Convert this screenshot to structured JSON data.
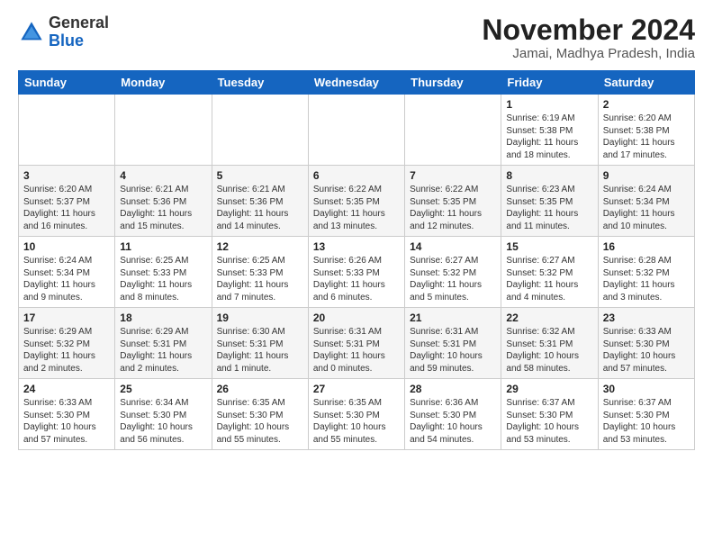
{
  "logo": {
    "general": "General",
    "blue": "Blue"
  },
  "header": {
    "month_title": "November 2024",
    "subtitle": "Jamai, Madhya Pradesh, India"
  },
  "weekdays": [
    "Sunday",
    "Monday",
    "Tuesday",
    "Wednesday",
    "Thursday",
    "Friday",
    "Saturday"
  ],
  "weeks": [
    [
      {
        "day": "",
        "info": ""
      },
      {
        "day": "",
        "info": ""
      },
      {
        "day": "",
        "info": ""
      },
      {
        "day": "",
        "info": ""
      },
      {
        "day": "",
        "info": ""
      },
      {
        "day": "1",
        "info": "Sunrise: 6:19 AM\nSunset: 5:38 PM\nDaylight: 11 hours and 18 minutes."
      },
      {
        "day": "2",
        "info": "Sunrise: 6:20 AM\nSunset: 5:38 PM\nDaylight: 11 hours and 17 minutes."
      }
    ],
    [
      {
        "day": "3",
        "info": "Sunrise: 6:20 AM\nSunset: 5:37 PM\nDaylight: 11 hours and 16 minutes."
      },
      {
        "day": "4",
        "info": "Sunrise: 6:21 AM\nSunset: 5:36 PM\nDaylight: 11 hours and 15 minutes."
      },
      {
        "day": "5",
        "info": "Sunrise: 6:21 AM\nSunset: 5:36 PM\nDaylight: 11 hours and 14 minutes."
      },
      {
        "day": "6",
        "info": "Sunrise: 6:22 AM\nSunset: 5:35 PM\nDaylight: 11 hours and 13 minutes."
      },
      {
        "day": "7",
        "info": "Sunrise: 6:22 AM\nSunset: 5:35 PM\nDaylight: 11 hours and 12 minutes."
      },
      {
        "day": "8",
        "info": "Sunrise: 6:23 AM\nSunset: 5:35 PM\nDaylight: 11 hours and 11 minutes."
      },
      {
        "day": "9",
        "info": "Sunrise: 6:24 AM\nSunset: 5:34 PM\nDaylight: 11 hours and 10 minutes."
      }
    ],
    [
      {
        "day": "10",
        "info": "Sunrise: 6:24 AM\nSunset: 5:34 PM\nDaylight: 11 hours and 9 minutes."
      },
      {
        "day": "11",
        "info": "Sunrise: 6:25 AM\nSunset: 5:33 PM\nDaylight: 11 hours and 8 minutes."
      },
      {
        "day": "12",
        "info": "Sunrise: 6:25 AM\nSunset: 5:33 PM\nDaylight: 11 hours and 7 minutes."
      },
      {
        "day": "13",
        "info": "Sunrise: 6:26 AM\nSunset: 5:33 PM\nDaylight: 11 hours and 6 minutes."
      },
      {
        "day": "14",
        "info": "Sunrise: 6:27 AM\nSunset: 5:32 PM\nDaylight: 11 hours and 5 minutes."
      },
      {
        "day": "15",
        "info": "Sunrise: 6:27 AM\nSunset: 5:32 PM\nDaylight: 11 hours and 4 minutes."
      },
      {
        "day": "16",
        "info": "Sunrise: 6:28 AM\nSunset: 5:32 PM\nDaylight: 11 hours and 3 minutes."
      }
    ],
    [
      {
        "day": "17",
        "info": "Sunrise: 6:29 AM\nSunset: 5:32 PM\nDaylight: 11 hours and 2 minutes."
      },
      {
        "day": "18",
        "info": "Sunrise: 6:29 AM\nSunset: 5:31 PM\nDaylight: 11 hours and 2 minutes."
      },
      {
        "day": "19",
        "info": "Sunrise: 6:30 AM\nSunset: 5:31 PM\nDaylight: 11 hours and 1 minute."
      },
      {
        "day": "20",
        "info": "Sunrise: 6:31 AM\nSunset: 5:31 PM\nDaylight: 11 hours and 0 minutes."
      },
      {
        "day": "21",
        "info": "Sunrise: 6:31 AM\nSunset: 5:31 PM\nDaylight: 10 hours and 59 minutes."
      },
      {
        "day": "22",
        "info": "Sunrise: 6:32 AM\nSunset: 5:31 PM\nDaylight: 10 hours and 58 minutes."
      },
      {
        "day": "23",
        "info": "Sunrise: 6:33 AM\nSunset: 5:30 PM\nDaylight: 10 hours and 57 minutes."
      }
    ],
    [
      {
        "day": "24",
        "info": "Sunrise: 6:33 AM\nSunset: 5:30 PM\nDaylight: 10 hours and 57 minutes."
      },
      {
        "day": "25",
        "info": "Sunrise: 6:34 AM\nSunset: 5:30 PM\nDaylight: 10 hours and 56 minutes."
      },
      {
        "day": "26",
        "info": "Sunrise: 6:35 AM\nSunset: 5:30 PM\nDaylight: 10 hours and 55 minutes."
      },
      {
        "day": "27",
        "info": "Sunrise: 6:35 AM\nSunset: 5:30 PM\nDaylight: 10 hours and 55 minutes."
      },
      {
        "day": "28",
        "info": "Sunrise: 6:36 AM\nSunset: 5:30 PM\nDaylight: 10 hours and 54 minutes."
      },
      {
        "day": "29",
        "info": "Sunrise: 6:37 AM\nSunset: 5:30 PM\nDaylight: 10 hours and 53 minutes."
      },
      {
        "day": "30",
        "info": "Sunrise: 6:37 AM\nSunset: 5:30 PM\nDaylight: 10 hours and 53 minutes."
      }
    ]
  ]
}
